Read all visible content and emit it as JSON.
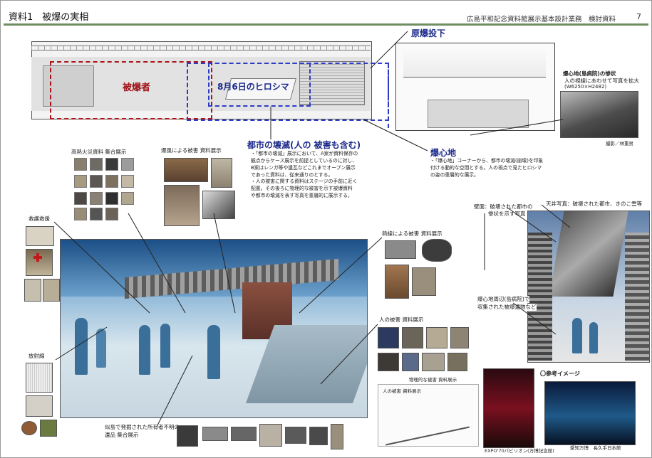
{
  "header": {
    "title": "資料1　被爆の実相",
    "right_text": "広島平和記念資料館展示基本設計業務　検討資料",
    "page_number": "7"
  },
  "plan": {
    "label_hibakusha": "被爆者",
    "label_aug6": "8月6日のヒロシマ",
    "label_drop": "原爆投下",
    "label_destruction": "都市の壊滅(人の 被害も含む)",
    "label_hypocenter": "爆心地"
  },
  "destruction_notes": [
    "・「都市の壊滅」展示において、A案が資料保存の",
    "観点からケース展示を前提としているのに対し、",
    "B案はレンガ等や遺瓦などこれまでオープン展示",
    "であった資料は、従来通りのとする。",
    "・人の被害に関する資料はステージの手前に近く",
    "配置。その後ろに物理的な被害を示す被爆資料",
    "や都市の壊滅を表す写真を重層的に展示する。"
  ],
  "hypocenter_notes": [
    "・「爆心地」コーナーから、都市の壊滅(崩壊)を印象",
    "付ける動的な空間とする。人の視点で見たヒロシマ",
    "の姿の重層的な展示。"
  ],
  "hypocenter_form": {
    "title": "爆心地(島病院)の惨状",
    "line1": "人の視線にあわせて写真を拡大",
    "line2": "(W6250×H2482)",
    "photo_caption": "撮影／林重男"
  },
  "captions": {
    "heat_materials": "高熱火災資料 集合展示",
    "blast_materials": "爆風による被害 資料展示",
    "rescue": "救護救援",
    "radiation": "放射線",
    "thermal_materials": "熱線による被害 資料展示",
    "human_damage": "人の被害 資料展示",
    "physical_damage": "物理的な被害 資料展示",
    "human_damage2": "人の被害 資料展示",
    "ninoshima_line1": "似島で発掘された所有者不明の",
    "ninoshima_line2": "遺品 集合展示",
    "ceiling": "天井写真：破壊された都市、きのこ雲等",
    "wall_line1": "壁面：破壊された都市の",
    "wall_line2": "惨状を示す写真",
    "around_line1": "爆心地周辺(島病院)で",
    "around_line2": "収集された被爆遺物など",
    "reference_title": "〇参考イメージ",
    "expo": "EXPO'70パビリオン(万博記念館)",
    "fukui": "愛知万博　長久手日本館"
  },
  "colors": {
    "header_rule": "#6f8f62",
    "red_zone": "#a8161b",
    "blue_zone": "#2e3cc4"
  }
}
